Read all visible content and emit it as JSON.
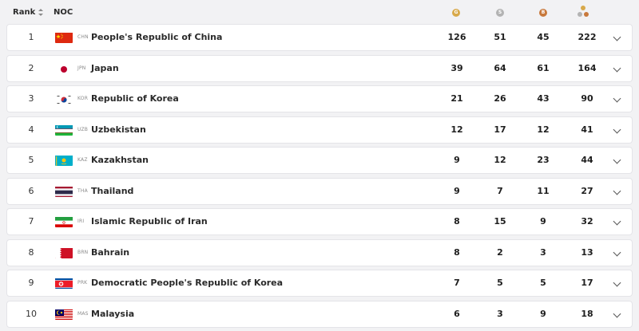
{
  "header": {
    "rank_label": "Rank",
    "noc_label": "NOC",
    "medal_letters": [
      "G",
      "S",
      "B"
    ]
  },
  "colors": {
    "gold": "#d8a94a",
    "silver": "#b3b3b3",
    "bronze": "#c8793c",
    "row_bg": "#ffffff",
    "page_bg": "#f2f2f4"
  },
  "rows": [
    {
      "rank": "1",
      "code": "CHN",
      "name": "People's Republic of China",
      "gold": "126",
      "silver": "51",
      "bronze": "45",
      "total": "222",
      "flag": "china-flag-icon"
    },
    {
      "rank": "2",
      "code": "JPN",
      "name": "Japan",
      "gold": "39",
      "silver": "64",
      "bronze": "61",
      "total": "164",
      "flag": "japan-flag-icon"
    },
    {
      "rank": "3",
      "code": "KOR",
      "name": "Republic of Korea",
      "gold": "21",
      "silver": "26",
      "bronze": "43",
      "total": "90",
      "flag": "korea-flag-icon"
    },
    {
      "rank": "4",
      "code": "UZB",
      "name": "Uzbekistan",
      "gold": "12",
      "silver": "17",
      "bronze": "12",
      "total": "41",
      "flag": "uzbekistan-flag-icon"
    },
    {
      "rank": "5",
      "code": "KAZ",
      "name": "Kazakhstan",
      "gold": "9",
      "silver": "12",
      "bronze": "23",
      "total": "44",
      "flag": "kazakhstan-flag-icon"
    },
    {
      "rank": "6",
      "code": "THA",
      "name": "Thailand",
      "gold": "9",
      "silver": "7",
      "bronze": "11",
      "total": "27",
      "flag": "thailand-flag-icon"
    },
    {
      "rank": "7",
      "code": "IRI",
      "name": "Islamic Republic of Iran",
      "gold": "8",
      "silver": "15",
      "bronze": "9",
      "total": "32",
      "flag": "iran-flag-icon"
    },
    {
      "rank": "8",
      "code": "BRN",
      "name": "Bahrain",
      "gold": "8",
      "silver": "2",
      "bronze": "3",
      "total": "13",
      "flag": "bahrain-flag-icon"
    },
    {
      "rank": "9",
      "code": "PRK",
      "name": "Democratic People's Republic of Korea",
      "gold": "7",
      "silver": "5",
      "bronze": "5",
      "total": "17",
      "flag": "dprk-flag-icon"
    },
    {
      "rank": "10",
      "code": "MAS",
      "name": "Malaysia",
      "gold": "6",
      "silver": "3",
      "bronze": "9",
      "total": "18",
      "flag": "malaysia-flag-icon"
    }
  ]
}
